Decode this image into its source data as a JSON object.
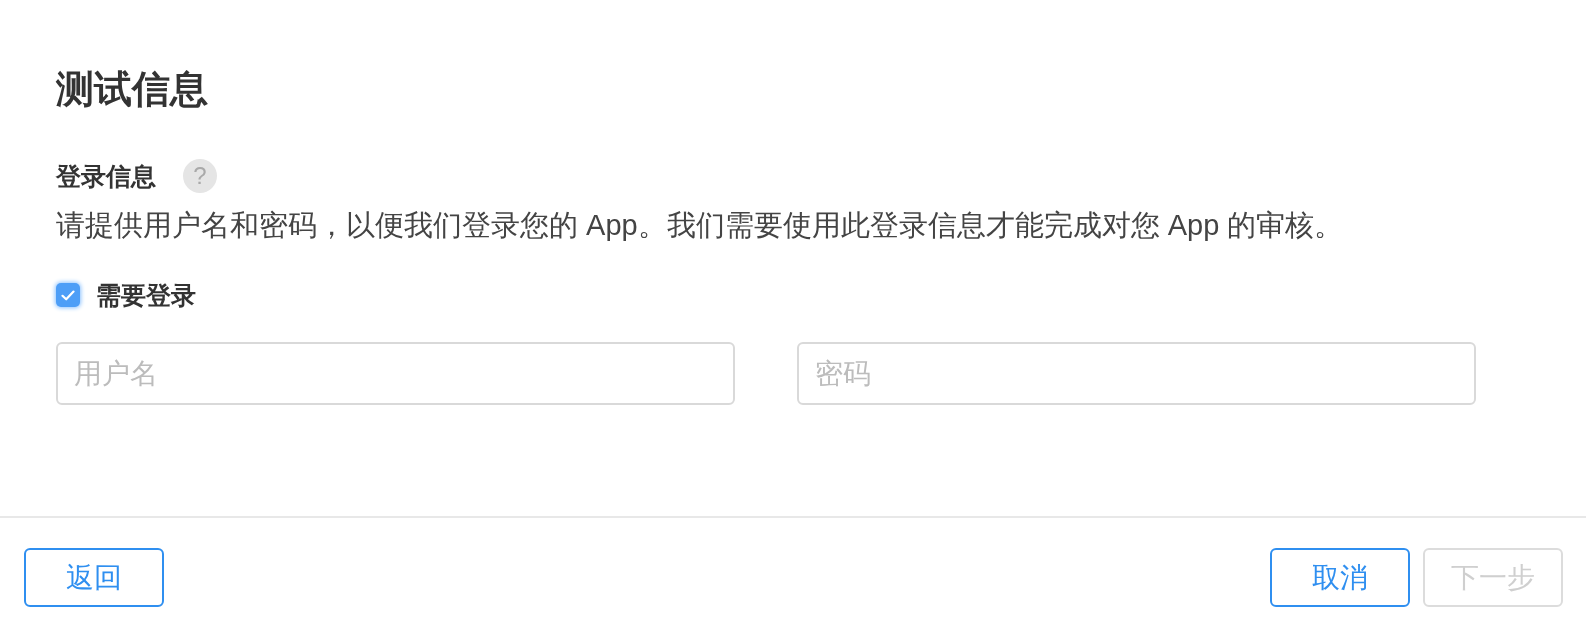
{
  "page": {
    "title": "测试信息"
  },
  "login_section": {
    "label": "登录信息",
    "help": "?",
    "description": "请提供用户名和密码，以便我们登录您的 App。我们需要使用此登录信息才能完成对您 App 的审核。",
    "require_login": {
      "label": "需要登录",
      "checked": true
    },
    "fields": [
      {
        "placeholder": "用户名"
      },
      {
        "placeholder": "密码"
      }
    ]
  },
  "footer": {
    "left_buttons": [
      {
        "label": "返回",
        "disabled": false
      }
    ],
    "right_buttons": [
      {
        "label": "取消",
        "disabled": false
      },
      {
        "label": "下一步",
        "disabled": true
      }
    ]
  }
}
